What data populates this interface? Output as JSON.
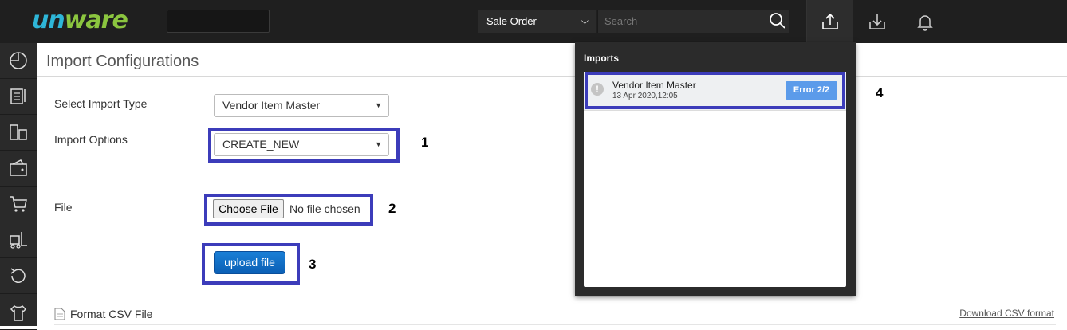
{
  "header": {
    "logo_prefix": "un",
    "logo_suffix": "ware",
    "module_select": "Sale Order",
    "search_placeholder": "Search",
    "icons": [
      "upload-icon",
      "download-icon",
      "bell-icon"
    ]
  },
  "sidebar": {
    "icons": [
      "dashboard-icon",
      "orders-icon",
      "inventory-icon",
      "wallet-icon",
      "cart-icon",
      "forklift-icon",
      "returns-icon",
      "shirt-icon"
    ]
  },
  "page": {
    "title": "Import Configurations",
    "import_type_label": "Select Import Type",
    "import_type_value": "Vendor Item Master",
    "import_options_label": "Import Options",
    "import_options_value": "CREATE_NEW",
    "file_label": "File",
    "choose_file_label": "Choose File",
    "no_file_text": "No file chosen",
    "upload_label": "upload file",
    "format_csv_label": "Format CSV File",
    "download_csv_label": "Download CSV format"
  },
  "annotations": {
    "n1": "1",
    "n2": "2",
    "n3": "3",
    "n4": "4",
    "highlight_color": "#3c3cba"
  },
  "imports_dropdown": {
    "title": "Imports",
    "items": [
      {
        "name": "Vendor Item Master",
        "timestamp": "13 Apr 2020,12:05",
        "status": "Error 2/2"
      }
    ]
  },
  "colors": {
    "topbar": "#1f1f1f",
    "sidebar": "#2a2a2a",
    "logo_blue": "#2eb6d8",
    "logo_green": "#8bc53f",
    "upload_button": "#0b5fb5",
    "error_badge": "#5b9bea"
  }
}
